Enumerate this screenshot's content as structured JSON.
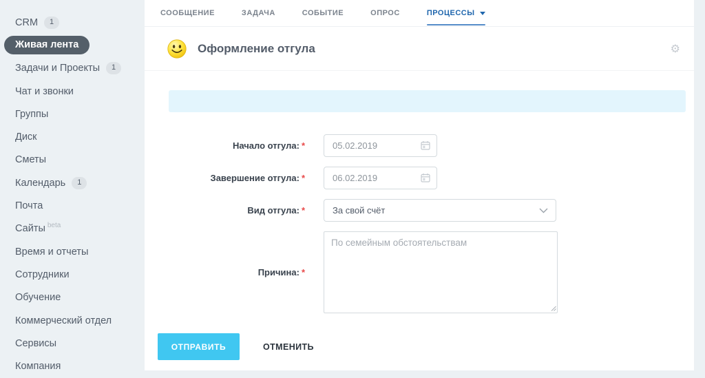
{
  "sidebar": {
    "items": [
      {
        "label": "CRM",
        "badge": "1"
      },
      {
        "label": "Живая лента",
        "active": true
      },
      {
        "label": "Задачи и Проекты",
        "badge": "1"
      },
      {
        "label": "Чат и звонки"
      },
      {
        "label": "Группы"
      },
      {
        "label": "Диск"
      },
      {
        "label": "Сметы"
      },
      {
        "label": "Календарь",
        "badge": "1"
      },
      {
        "label": "Почта"
      },
      {
        "label": "Сайты",
        "sup": "beta"
      },
      {
        "label": "Время и отчеты"
      },
      {
        "label": "Сотрудники"
      },
      {
        "label": "Обучение"
      },
      {
        "label": "Коммерческий отдел"
      },
      {
        "label": "Сервисы"
      },
      {
        "label": "Компания"
      }
    ]
  },
  "tabs": [
    {
      "label": "СООБЩЕНИЕ"
    },
    {
      "label": "ЗАДАЧА"
    },
    {
      "label": "СОБЫТИЕ"
    },
    {
      "label": "ОПРОС"
    },
    {
      "label": "ПРОЦЕССЫ",
      "active": true,
      "has_dropdown": true
    }
  ],
  "form": {
    "title": "Оформление отгула",
    "required_mark": "*",
    "fields": [
      {
        "label": "Начало отгула:",
        "type": "date",
        "value": "05.02.2019"
      },
      {
        "label": "Завершение отгула:",
        "type": "date",
        "value": "06.02.2019"
      },
      {
        "label": "Вид отгула:",
        "type": "select",
        "value": "За свой счёт"
      },
      {
        "label": "Причина:",
        "type": "textarea",
        "placeholder": "По семейным обстоятельствам"
      }
    ],
    "buttons": {
      "submit": "ОТПРАВИТЬ",
      "cancel": "ОТМЕНИТЬ"
    }
  },
  "colors": {
    "page_background": "#ecf1f4",
    "panel_background": "#ffffff",
    "active_tab_text": "#1f66ad",
    "active_tab_underline": "#558cc9",
    "active_sidebar_pill": "#545f69",
    "badge_background": "#dde2e6",
    "info_banner": "#e3f5fd",
    "submit_button": "#40c7f1",
    "required_mark": "#e84a4a",
    "input_border": "#d4dade"
  }
}
